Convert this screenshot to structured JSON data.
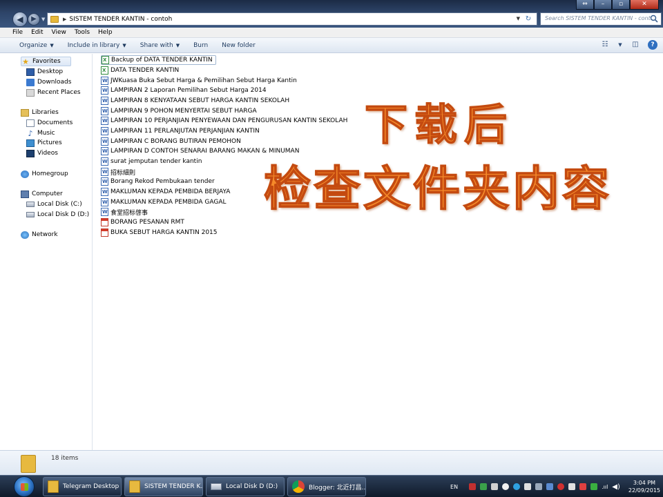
{
  "window": {
    "address_path": "SISTEM TENDER KANTIN - contoh",
    "search_placeholder": "Search SISTEM TENDER KANTIN - cont...",
    "controls": {
      "restore": "⇔",
      "minimize": "–",
      "maximize": "▫",
      "close": "✕"
    }
  },
  "menu": [
    "File",
    "Edit",
    "View",
    "Tools",
    "Help"
  ],
  "toolbar": {
    "organize": "Organize",
    "include_in_library": "Include in library",
    "share_with": "Share with",
    "burn": "Burn",
    "new_folder": "New folder"
  },
  "nav": {
    "favorites": "Favorites",
    "desktop": "Desktop",
    "downloads": "Downloads",
    "recent_places": "Recent Places",
    "libraries": "Libraries",
    "documents": "Documents",
    "music": "Music",
    "pictures": "Pictures",
    "videos": "Videos",
    "homegroup": "Homegroup",
    "computer": "Computer",
    "local_disk_c": "Local Disk (C:)",
    "local_disk_d": "Local Disk D (D:)",
    "network": "Network"
  },
  "files": [
    {
      "name": "Backup of DATA TENDER KANTIN",
      "type": "excel"
    },
    {
      "name": "DATA TENDER KANTIN",
      "type": "excel"
    },
    {
      "name": "JWKuasa Buka Sebut Harga & Pemilihan Sebut Harga Kantin",
      "type": "word"
    },
    {
      "name": "LAMPIRAN 2 Laporan Pemilihan Sebut Harga 2014",
      "type": "word"
    },
    {
      "name": "LAMPIRAN 8 KENYATAAN SEBUT HARGA KANTIN SEKOLAH",
      "type": "word"
    },
    {
      "name": "LAMPIRAN 9 POHON MENYERTAI SEBUT HARGA",
      "type": "word"
    },
    {
      "name": "LAMPIRAN 10 PERJANJIAN PENYEWAAN DAN PENGURUSAN KANTIN SEKOLAH",
      "type": "word"
    },
    {
      "name": "LAMPIRAN 11 PERLANJUTAN PERJANJIAN KANTIN",
      "type": "word"
    },
    {
      "name": "LAMPIRAN C BORANG BUTIRAN PEMOHON",
      "type": "word"
    },
    {
      "name": "LAMPIRAN D CONTOH SENARAI BARANG MAKAN & MINUMAN",
      "type": "word"
    },
    {
      "name": "surat jemputan tender kantin",
      "type": "word"
    },
    {
      "name": "招标細則",
      "type": "word"
    },
    {
      "name": "Borang Rekod Pembukaan tender",
      "type": "word"
    },
    {
      "name": "MAKLUMAN KEPADA PEMBIDA BERJAYA",
      "type": "word"
    },
    {
      "name": "MAKLUMAN KEPADA PEMBIDA GAGAL",
      "type": "word"
    },
    {
      "name": "食堂招标啓事",
      "type": "word"
    },
    {
      "name": "BORANG PESANAN RMT",
      "type": "pdf"
    },
    {
      "name": "BUKA SEBUT HARGA KANTIN 2015",
      "type": "pdf"
    }
  ],
  "overlay": {
    "line1": "下载后",
    "line2": "检查文件夹内容"
  },
  "status": {
    "item_count": "18 items"
  },
  "taskbar": {
    "items": [
      "Telegram Desktop",
      "SISTEM TENDER K...",
      "Local Disk D (D:)",
      "Blogger: 北近打昌..."
    ],
    "language": "EN",
    "time": "3:04 PM",
    "date": "22/09/2015"
  },
  "colors": {
    "overlay_text": "#f58a2a",
    "overlay_outline": "#c44a10"
  }
}
